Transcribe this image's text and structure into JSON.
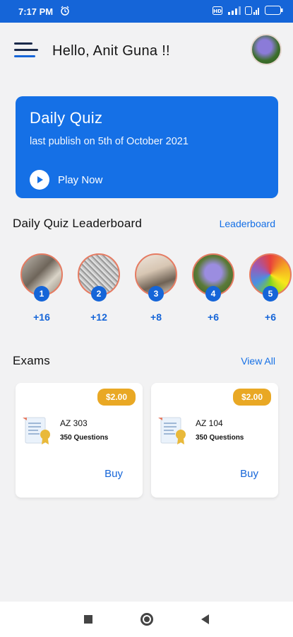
{
  "status_bar": {
    "time": "7:17 PM",
    "battery": "7",
    "icons": [
      "alarm-icon",
      "hd-icon",
      "signal-icon",
      "wifi-icon",
      "battery-icon"
    ]
  },
  "header": {
    "greeting": "Hello, Anit Guna !!"
  },
  "quiz_card": {
    "title": "Daily Quiz",
    "subtitle": "last publish on 5th of October 2021",
    "play_label": "Play Now"
  },
  "leaderboard": {
    "title": "Daily Quiz Leaderboard",
    "link": "Leaderboard",
    "leaders": [
      {
        "rank": "1",
        "score": "+16"
      },
      {
        "rank": "2",
        "score": "+12"
      },
      {
        "rank": "3",
        "score": "+8"
      },
      {
        "rank": "4",
        "score": "+6"
      },
      {
        "rank": "5",
        "score": "+6"
      }
    ]
  },
  "exams": {
    "title": "Exams",
    "link": "View All",
    "items": [
      {
        "price": "$2.00",
        "code": "AZ 303",
        "questions": "350 Questions",
        "buy": "Buy"
      },
      {
        "price": "$2.00",
        "code": "AZ 104",
        "questions": "350 Questions",
        "buy": "Buy"
      }
    ]
  },
  "colors": {
    "primary": "#1565d8",
    "price_badge": "#e9a824",
    "background": "#f2f2f3"
  }
}
